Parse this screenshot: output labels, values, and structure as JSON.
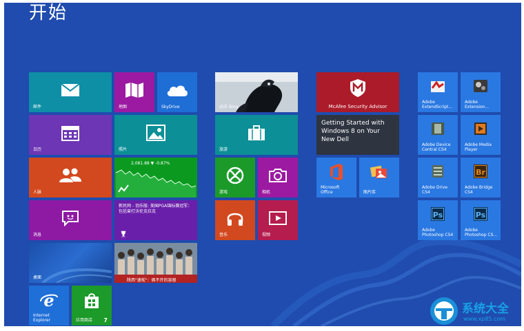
{
  "start": {
    "title": "开始"
  },
  "tiles": {
    "mail": {
      "label": "邮件",
      "color": "#0e8fa6"
    },
    "maps": {
      "label": "地图",
      "color": "#9c1aa1"
    },
    "skydrive": {
      "label": "SkyDrive",
      "color": "#1e6ed6"
    },
    "calendar": {
      "label": "日历",
      "color": "#6d36b4"
    },
    "photos": {
      "label": "照片",
      "color": "#0c8f97"
    },
    "people": {
      "label": "人脉",
      "color": "#d2491f"
    },
    "finance": {
      "label": "",
      "ticker": "2,081.88 ▼ -0.87%",
      "color": "#0b9a1f"
    },
    "messaging": {
      "label": "消息",
      "color": "#8e1aa3"
    },
    "sports": {
      "label": "",
      "headline": "新民网 - 羽乐版: 美国PGA锦标赛冠军：包括曾打沃伦克拉克",
      "color": "#6a1faa"
    },
    "desktop": {
      "label": "桌面",
      "color": "#1b4fa9"
    },
    "news": {
      "label": "",
      "caption": "陕西\"速啦\"：俩不开的容留",
      "color": "#b32322"
    },
    "ie": {
      "label": "Internet Explorer",
      "color": "#1f6fd8"
    },
    "store": {
      "label": "应用商店",
      "badge": "7",
      "color": "#1c9a2a"
    },
    "bing": {
      "label": "必应 Bing",
      "color": "#2a3a5a"
    },
    "travel": {
      "label": "旅游",
      "color": "#0c8f97"
    },
    "games": {
      "label": "游戏",
      "color": "#1b9a2a"
    },
    "camera": {
      "label": "相机",
      "color": "#9c1aa1"
    },
    "music": {
      "label": "音乐",
      "color": "#d2491f"
    },
    "video": {
      "label": "视频",
      "color": "#b51d4e"
    },
    "mcafee": {
      "label": "McAfee Security Advisor",
      "color": "#ac1b2a"
    },
    "dell": {
      "text": "Getting Started with Windows 8 on Your New Dell",
      "color": "#2e3440"
    },
    "office": {
      "label": "Microsoft Office",
      "color": "#2a78e2"
    },
    "gallery": {
      "label": "图片库",
      "color": "#2a78e2"
    },
    "extendscript": {
      "label": "Adobe ExtendScript...",
      "color": "#2a78e2"
    },
    "extension": {
      "label": "Adobe Extension...",
      "color": "#2a78e2"
    },
    "devicecentral": {
      "label": "Adobe Device Central CS4",
      "color": "#2a78e2"
    },
    "mediaplayer": {
      "label": "Adobe Media Player",
      "color": "#2a78e2"
    },
    "drive": {
      "label": "Adobe Drive CS4",
      "color": "#2a78e2"
    },
    "bridge": {
      "label": "Adobe Bridge CS4",
      "color": "#2a78e2"
    },
    "photoshop1": {
      "label": "Adobe Photoshop CS4",
      "color": "#2a78e2"
    },
    "photoshop2": {
      "label": "Adobe Photoshop CS...",
      "color": "#2a78e2"
    }
  },
  "watermark": {
    "title": "系统大全",
    "url": "www.xp85.com"
  }
}
